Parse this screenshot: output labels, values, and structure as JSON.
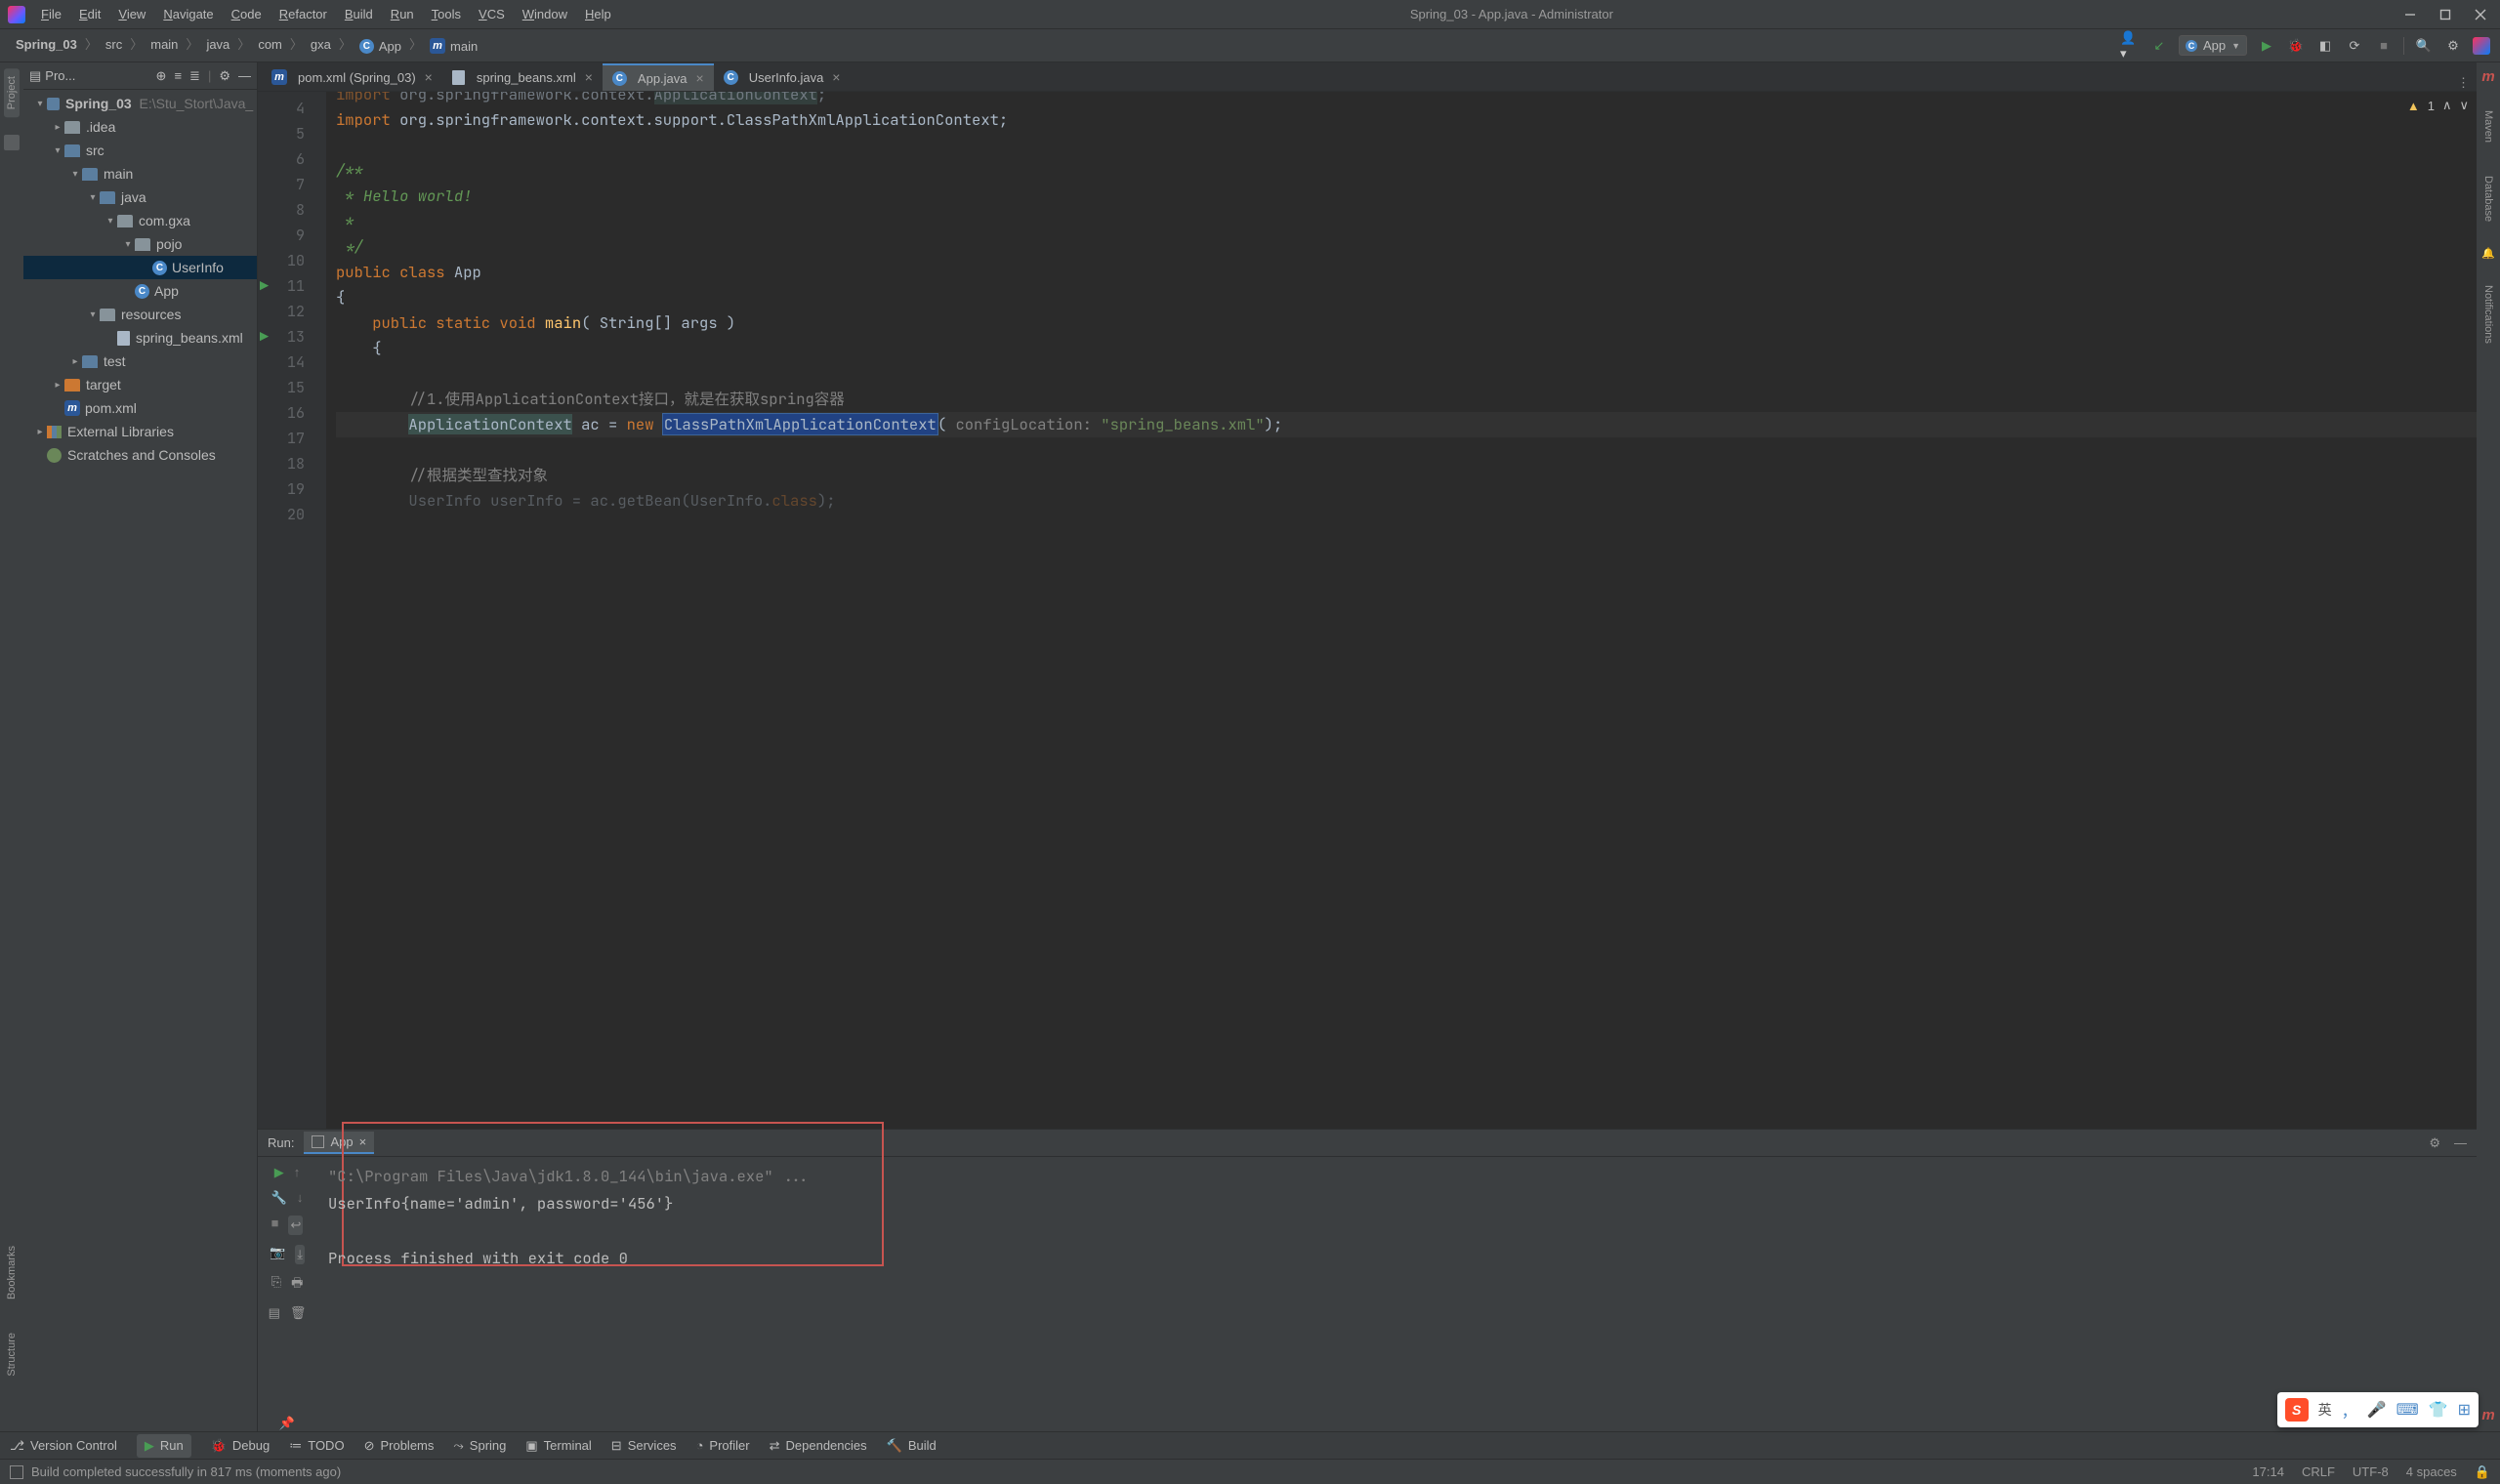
{
  "window": {
    "title": "Spring_03 - App.java - Administrator",
    "menu": [
      "File",
      "Edit",
      "View",
      "Navigate",
      "Code",
      "Refactor",
      "Build",
      "Run",
      "Tools",
      "VCS",
      "Window",
      "Help"
    ]
  },
  "breadcrumbs": [
    "Spring_03",
    "src",
    "main",
    "java",
    "com",
    "gxa",
    "App",
    "main"
  ],
  "nav_run": {
    "config": "App"
  },
  "project_panel_label": "Pro...",
  "project_tree": {
    "root": {
      "name": "Spring_03",
      "hint": "E:\\Stu_Stort\\Java_"
    },
    "items": [
      {
        "indent": 0,
        "open": true,
        "bold": true,
        "icon": "mod",
        "name": "Spring_03",
        "hint": "E:\\Stu_Stort\\Java_"
      },
      {
        "indent": 1,
        "open": false,
        "icon": "folder",
        "name": ".idea"
      },
      {
        "indent": 1,
        "open": true,
        "icon": "folder-b",
        "name": "src"
      },
      {
        "indent": 2,
        "open": true,
        "icon": "folder-b",
        "name": "main"
      },
      {
        "indent": 3,
        "open": true,
        "icon": "folder-b",
        "name": "java"
      },
      {
        "indent": 4,
        "open": true,
        "icon": "folder",
        "name": "com.gxa"
      },
      {
        "indent": 5,
        "open": true,
        "icon": "folder",
        "name": "pojo"
      },
      {
        "indent": 6,
        "icon": "class",
        "name": "UserInfo",
        "sel": true
      },
      {
        "indent": 5,
        "icon": "class",
        "name": "App"
      },
      {
        "indent": 3,
        "open": true,
        "icon": "folder",
        "name": "resources"
      },
      {
        "indent": 4,
        "icon": "file",
        "name": "spring_beans.xml"
      },
      {
        "indent": 2,
        "open": false,
        "icon": "folder-b",
        "name": "test"
      },
      {
        "indent": 1,
        "open": false,
        "icon": "folder-o",
        "name": "target"
      },
      {
        "indent": 1,
        "icon": "m",
        "name": "pom.xml"
      },
      {
        "indent": 0,
        "open": false,
        "icon": "lib",
        "name": "External Libraries"
      },
      {
        "indent": 0,
        "icon": "scr",
        "name": "Scratches and Consoles"
      }
    ]
  },
  "left_rail": [
    "Project",
    "Bookmarks",
    "Structure"
  ],
  "right_rail": [
    "Maven",
    "Database",
    "Notifications"
  ],
  "editor": {
    "tabs": [
      {
        "label": "pom.xml (Spring_03)",
        "icon": "m"
      },
      {
        "label": "spring_beans.xml",
        "icon": "file"
      },
      {
        "label": "App.java",
        "icon": "class",
        "active": true
      },
      {
        "label": "UserInfo.java",
        "icon": "class"
      }
    ],
    "warnings": "1",
    "first_line": 4,
    "lines": [
      {
        "n": 4,
        "tok": [
          [
            "k",
            "import "
          ],
          [
            "n",
            "org.springframework.context."
          ],
          [
            "hl",
            "ApplicationContext"
          ],
          [
            "n",
            ";"
          ]
        ],
        "dimtop": true
      },
      {
        "n": 5,
        "tok": [
          [
            "k",
            "import "
          ],
          [
            "n",
            "org.springframework.context.support.ClassPathXmlApplicationContext;"
          ]
        ]
      },
      {
        "n": 6,
        "tok": []
      },
      {
        "n": 7,
        "tok": [
          [
            "d",
            "/**"
          ]
        ]
      },
      {
        "n": 8,
        "tok": [
          [
            "d",
            " * Hello world!"
          ]
        ]
      },
      {
        "n": 9,
        "tok": [
          [
            "d",
            " *"
          ]
        ]
      },
      {
        "n": 10,
        "tok": [
          [
            "d",
            " */"
          ]
        ]
      },
      {
        "n": 11,
        "run": true,
        "tok": [
          [
            "k",
            "public class "
          ],
          [
            "n",
            "App"
          ]
        ]
      },
      {
        "n": 12,
        "tok": [
          [
            "n",
            "{"
          ]
        ]
      },
      {
        "n": 13,
        "run": true,
        "tok": [
          [
            "n",
            "    "
          ],
          [
            "k",
            "public static "
          ],
          [
            "k",
            "void "
          ],
          [
            "f",
            "main"
          ],
          [
            "n",
            "( String[] args )"
          ]
        ]
      },
      {
        "n": 14,
        "tok": [
          [
            "n",
            "    {"
          ]
        ]
      },
      {
        "n": 15,
        "tok": []
      },
      {
        "n": 16,
        "tok": [
          [
            "n",
            "        "
          ],
          [
            "c",
            "//1.使用ApplicationContext接口，就是在获取spring容器"
          ]
        ]
      },
      {
        "n": 17,
        "cur": true,
        "tok": [
          [
            "n",
            "        "
          ],
          [
            "hl",
            "ApplicationContext"
          ],
          [
            "n",
            " ac = "
          ],
          [
            "k",
            "new "
          ],
          [
            "hlbox",
            "ClassPathXmlApplicationContext"
          ],
          [
            "n",
            "( "
          ],
          [
            "c",
            "configLocation: "
          ],
          [
            "s",
            "\"spring_beans.xml\""
          ],
          [
            "n",
            ");"
          ]
        ]
      },
      {
        "n": 18,
        "tok": []
      },
      {
        "n": 19,
        "tok": [
          [
            "n",
            "        "
          ],
          [
            "c",
            "//根据类型查找对象"
          ]
        ]
      },
      {
        "n": 20,
        "tok": [
          [
            "n",
            "        UserInfo userInfo = ac"
          ],
          [
            "n",
            ".getBean(UserInfo."
          ],
          [
            "k",
            "class"
          ],
          [
            "n",
            ");"
          ]
        ],
        "fade": true
      }
    ]
  },
  "run": {
    "label": "Run:",
    "tab": "App",
    "lines": [
      "\"C:\\Program Files\\Java\\jdk1.8.0_144\\bin\\java.exe\" ...",
      "UserInfo{name='admin', password='456'}",
      "",
      "Process finished with exit code 0"
    ]
  },
  "bottom_tabs": [
    {
      "label": "Version Control",
      "icon": "branch"
    },
    {
      "label": "Run",
      "icon": "play",
      "active": true
    },
    {
      "label": "Debug",
      "icon": "bug"
    },
    {
      "label": "TODO",
      "icon": "list"
    },
    {
      "label": "Problems",
      "icon": "warn"
    },
    {
      "label": "Spring",
      "icon": "leaf"
    },
    {
      "label": "Terminal",
      "icon": "term"
    },
    {
      "label": "Services",
      "icon": "svc"
    },
    {
      "label": "Profiler",
      "icon": "prof"
    },
    {
      "label": "Dependencies",
      "icon": "dep"
    },
    {
      "label": "Build",
      "icon": "hammer"
    }
  ],
  "status": {
    "msg": "Build completed successfully in 817 ms (moments ago)",
    "time": "17:14",
    "eol": "CRLF",
    "enc": "UTF-8",
    "indent": "4 spaces"
  },
  "ime": {
    "lang": "英",
    "punct": "，"
  }
}
